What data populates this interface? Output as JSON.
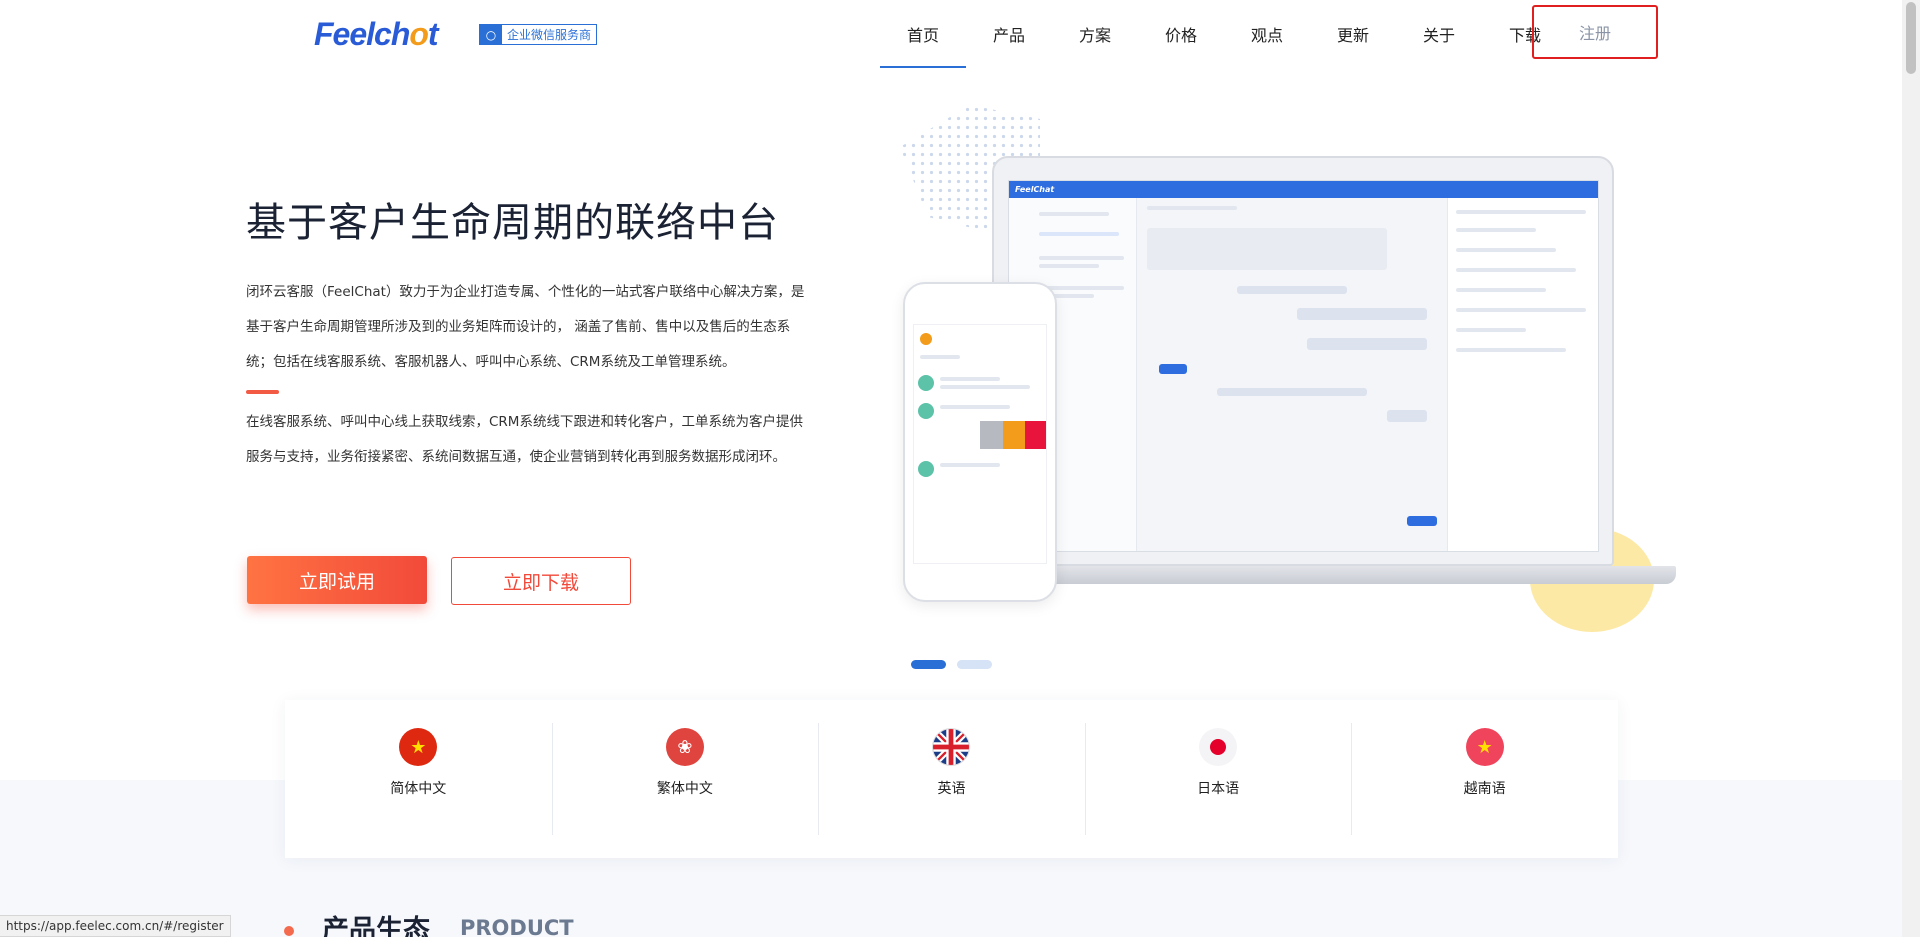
{
  "header": {
    "logo_main": "Feelch",
    "logo_o": "o",
    "logo_end": "t",
    "badge_text": "企业微信服务商",
    "nav": [
      {
        "label": "首页",
        "active": true
      },
      {
        "label": "产品",
        "active": false
      },
      {
        "label": "方案",
        "active": false
      },
      {
        "label": "价格",
        "active": false
      },
      {
        "label": "观点",
        "active": false
      },
      {
        "label": "更新",
        "active": false
      },
      {
        "label": "关于",
        "active": false
      },
      {
        "label": "下载",
        "active": false
      }
    ],
    "register_label": "注册"
  },
  "hero": {
    "title": "基于客户生命周期的联络中台",
    "paragraph1": "闭环云客服（FeelChat）致力于为企业打造专属、个性化的一站式客户联络中心解决方案，是基于客户生命周期管理所涉及到的业务矩阵而设计的， 涵盖了售前、售中以及售后的生态系统；包括在线客服系统、客服机器人、呼叫中心系统、CRM系统及工单管理系统。",
    "paragraph2": "在线客服系统、呼叫中心线上获取线索，CRM系统线下跟进和转化客户，工单系统为客户提供服务与支持，业务衔接紧密、系统间数据互通，使企业营销到转化再到服务数据形成闭环。",
    "try_button": "立即试用",
    "download_button": "立即下载",
    "mini_logo": "FeelChat"
  },
  "carousel": {
    "total": 2,
    "active_index": 0
  },
  "languages": [
    {
      "label": "简体中文",
      "flag": "cn-flag-icon"
    },
    {
      "label": "繁体中文",
      "flag": "hk-flag-icon"
    },
    {
      "label": "英语",
      "flag": "uk-flag-icon"
    },
    {
      "label": "日本语",
      "flag": "jp-flag-icon"
    },
    {
      "label": "越南语",
      "flag": "vn-flag-icon"
    }
  ],
  "product": {
    "title": "产品生态",
    "subtitle": "PRODUCT"
  },
  "status_bar": {
    "url": "https://app.feelec.com.cn/#/register"
  },
  "colors": {
    "brand_blue": "#2a6fd6",
    "accent_red": "#f24a3a",
    "register_border": "#e02020"
  }
}
